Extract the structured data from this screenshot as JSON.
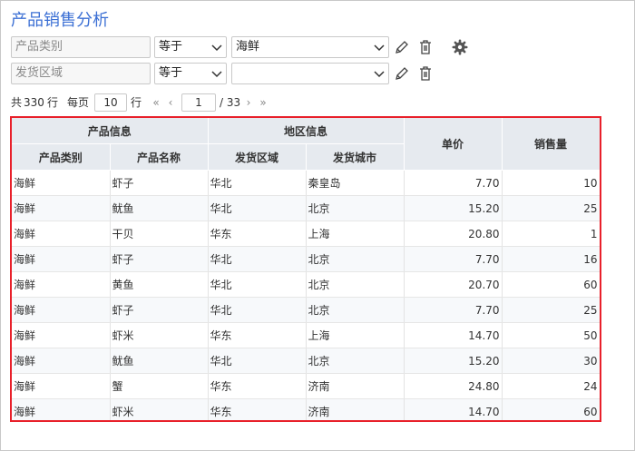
{
  "title": "产品销售分析",
  "filters": [
    {
      "field": "产品类别",
      "operator": "等于",
      "value": ""
    },
    {
      "field": "发货区域",
      "operator": "等于",
      "value": ""
    }
  ],
  "filter_values": [
    "海鲜",
    ""
  ],
  "icons": {
    "edit": "pencil-icon",
    "delete": "trash-icon",
    "settings": "gear-icon"
  },
  "pager": {
    "total_prefix": "共",
    "total": "330",
    "total_unit": "行",
    "per_page_label": "每页",
    "per_page": "10",
    "per_page_unit": "行",
    "current_page": "1",
    "total_pages": "/ 33"
  },
  "table": {
    "group_headers": [
      "产品信息",
      "地区信息"
    ],
    "headers": [
      "产品类别",
      "产品名称",
      "发货区域",
      "发货城市",
      "单价",
      "销售量"
    ],
    "rows": [
      [
        "海鲜",
        "虾子",
        "华北",
        "秦皇岛",
        "7.70",
        "10"
      ],
      [
        "海鲜",
        "鱿鱼",
        "华北",
        "北京",
        "15.20",
        "25"
      ],
      [
        "海鲜",
        "干贝",
        "华东",
        "上海",
        "20.80",
        "1"
      ],
      [
        "海鲜",
        "虾子",
        "华北",
        "北京",
        "7.70",
        "16"
      ],
      [
        "海鲜",
        "黄鱼",
        "华北",
        "北京",
        "20.70",
        "60"
      ],
      [
        "海鲜",
        "虾子",
        "华北",
        "北京",
        "7.70",
        "25"
      ],
      [
        "海鲜",
        "虾米",
        "华东",
        "上海",
        "14.70",
        "50"
      ],
      [
        "海鲜",
        "鱿鱼",
        "华北",
        "北京",
        "15.20",
        "30"
      ],
      [
        "海鲜",
        "蟹",
        "华东",
        "济南",
        "24.80",
        "24"
      ],
      [
        "海鲜",
        "虾米",
        "华东",
        "济南",
        "14.70",
        "60"
      ]
    ]
  },
  "colors": {
    "title": "#3b6fd4",
    "highlight_border": "#e8202a",
    "header_bg": "#e6eaef"
  }
}
